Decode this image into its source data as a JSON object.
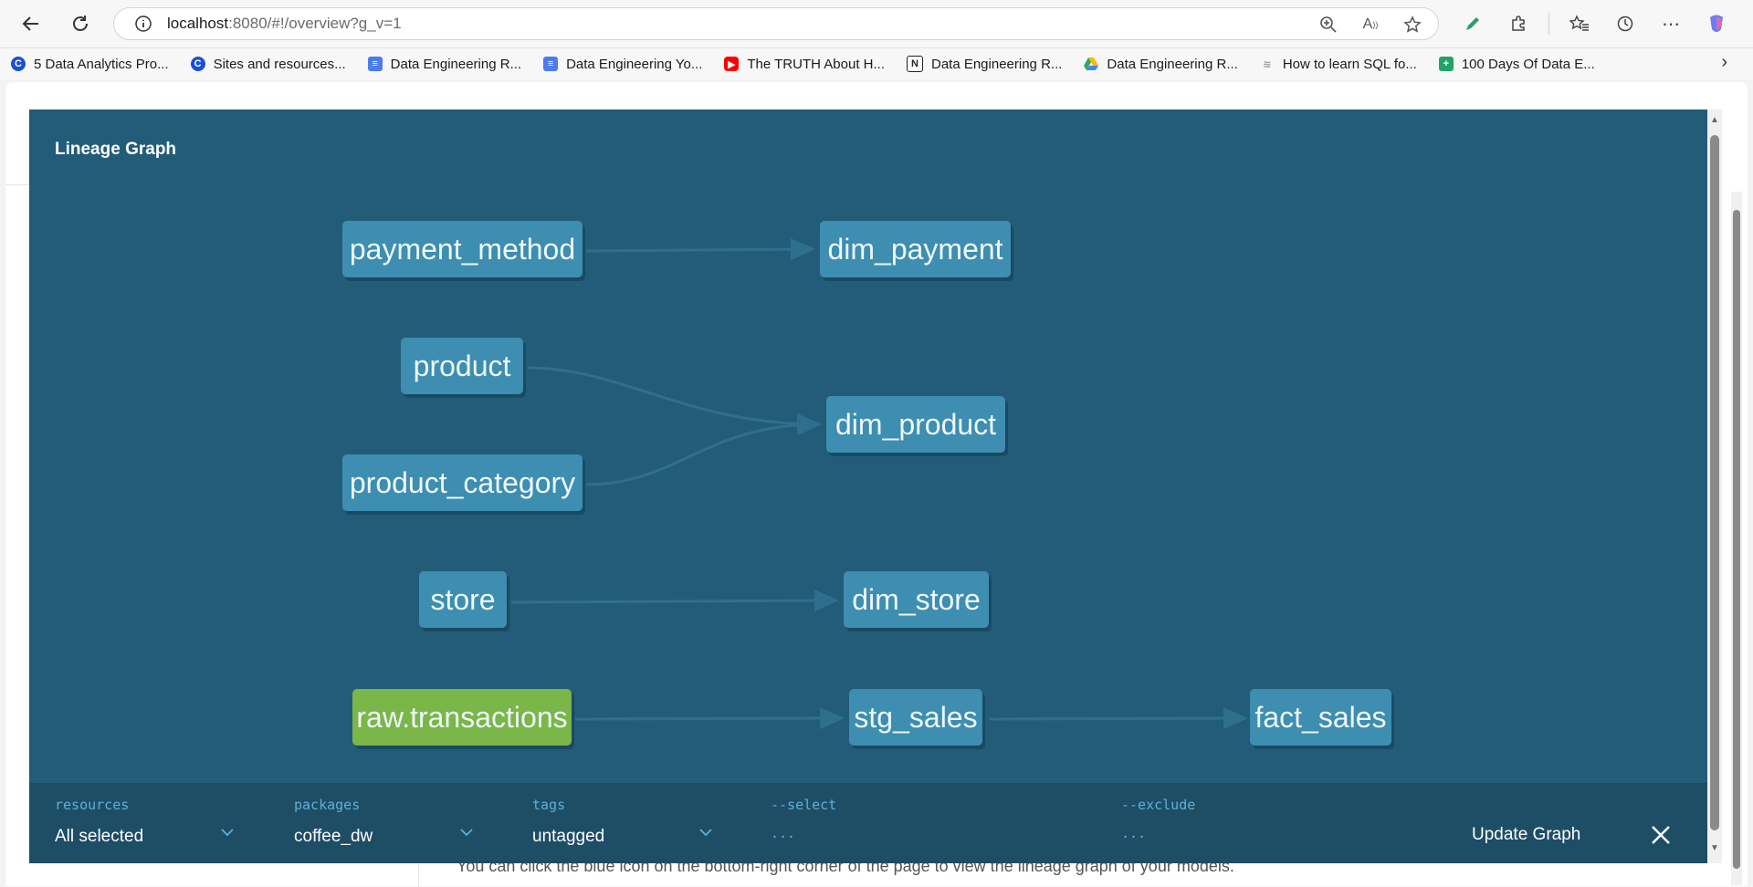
{
  "browser": {
    "url_host": "localhost",
    "url_rest": ":8080/#!/overview?g_v=1",
    "bookmarks": [
      {
        "label": "5 Data Analytics Pro...",
        "icon": "c-logo-icon",
        "color": "#1a4fd6"
      },
      {
        "label": "Sites and resources...",
        "icon": "c-logo-icon",
        "color": "#1a4fd6"
      },
      {
        "label": "Data Engineering R...",
        "icon": "google-docs-icon",
        "color": "#4b7bec"
      },
      {
        "label": "Data Engineering Yo...",
        "icon": "google-docs-icon",
        "color": "#4b7bec"
      },
      {
        "label": "The TRUTH About H...",
        "icon": "youtube-icon",
        "color": "#ff0000"
      },
      {
        "label": "Data Engineering R...",
        "icon": "notion-icon",
        "color": "#222222"
      },
      {
        "label": "Data Engineering R...",
        "icon": "google-drive-icon",
        "color": "#34a853"
      },
      {
        "label": "How to learn SQL fo...",
        "icon": "wave-icon",
        "color": "#999999"
      },
      {
        "label": "100 Days Of Data E...",
        "icon": "google-sheets-icon",
        "color": "#21a366"
      }
    ]
  },
  "page": {
    "hint_text": "You can click the blue icon on the bottom-right corner of the page to view the lineage graph of your models."
  },
  "modal": {
    "title": "Lineage Graph",
    "colors": {
      "background": "#235c78",
      "node": "#3d8eb0",
      "source_node": "#7ab648",
      "edge": "#2f6f8e"
    },
    "nodes": {
      "payment_method": "payment_method",
      "dim_payment": "dim_payment",
      "product": "product",
      "dim_product": "dim_product",
      "product_category": "product_category",
      "store": "store",
      "dim_store": "dim_store",
      "raw_transactions": "raw.transactions",
      "stg_sales": "stg_sales",
      "fact_sales": "fact_sales"
    },
    "filters": {
      "resources": {
        "label": "resources",
        "value": "All selected"
      },
      "packages": {
        "label": "packages",
        "value": "coffee_dw"
      },
      "tags": {
        "label": "tags",
        "value": "untagged"
      },
      "select": {
        "label": "--select",
        "placeholder": "..."
      },
      "exclude": {
        "label": "--exclude",
        "placeholder": "..."
      }
    },
    "update_label": "Update Graph"
  }
}
